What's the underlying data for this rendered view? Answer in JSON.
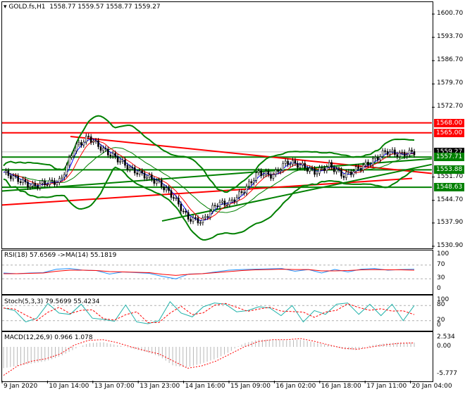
{
  "header": {
    "symbol": "GOLD.fs,H1",
    "ohlc": "1558.77 1559.57 1558.77 1559.27"
  },
  "price_axis": [
    "1600.70",
    "1593.70",
    "1586.70",
    "1579.70",
    "1572.70",
    "1551.70",
    "1544.70",
    "1537.90",
    "1530.90"
  ],
  "price_labels": [
    {
      "text": "1568.00",
      "price": 1568.0,
      "color": "#ff0000"
    },
    {
      "text": "1565.00",
      "price": 1565.0,
      "color": "#ff0000"
    },
    {
      "text": "1559.27",
      "price": 1559.27,
      "color": "#000000"
    },
    {
      "text": "1557.71",
      "price": 1557.71,
      "color": "#008000"
    },
    {
      "text": "1553.88",
      "price": 1553.88,
      "color": "#008000"
    },
    {
      "text": "1548.63",
      "price": 1548.63,
      "color": "#008000"
    }
  ],
  "closes": [
    1553.1,
    1551,
    1548.9,
    1550,
    1550.4,
    1560.5,
    1563.7,
    1560,
    1557.3,
    1554,
    1552.1,
    1549.9,
    1545.7,
    1539.4,
    1538.3,
    1543.6,
    1544,
    1547.8,
    1553.1,
    1552.1,
    1556.3,
    1555.2,
    1553.1,
    1555.2,
    1552.1,
    1554.2,
    1556.3,
    1559.5,
    1558.4,
    1559.27
  ],
  "rsi": {
    "label": "RSI(18) 57.6569  ->MA(14) 55.1819",
    "levels": [
      "100",
      "70",
      "30",
      "0"
    ],
    "values": [
      47,
      45,
      47,
      48,
      58,
      60,
      55,
      54,
      44,
      50,
      48,
      46,
      37,
      30,
      44,
      45,
      50,
      55,
      57,
      58,
      59,
      60,
      52,
      57,
      47,
      57,
      50,
      58,
      60,
      55,
      57,
      58
    ],
    "ma": [
      45,
      45,
      46,
      47,
      52,
      55,
      55,
      54,
      51,
      50,
      49,
      48,
      43,
      40,
      43,
      45,
      48,
      51,
      54,
      56,
      57,
      58,
      57,
      57,
      53,
      53,
      54,
      56,
      57,
      56,
      56,
      55
    ]
  },
  "stoch": {
    "label": "Stoch(5,3,3) 79.5699 55.4234",
    "levels": [
      "100",
      "80",
      "20",
      "0"
    ],
    "main": [
      70,
      60,
      15,
      30,
      88,
      50,
      45,
      85,
      30,
      25,
      18,
      82,
      15,
      8,
      20,
      95,
      50,
      35,
      75,
      90,
      85,
      55,
      60,
      75,
      70,
      40,
      80,
      15,
      60,
      45,
      85,
      90,
      45,
      85,
      40,
      85,
      20,
      80
    ]
  },
  "macd": {
    "label": "MACD(12,26,9) 0.966 1.078",
    "levels": [
      "2.534",
      "0.00",
      "-5.777"
    ],
    "hist": [
      -4.5,
      -4,
      -3.5,
      -3,
      -2,
      -0.5,
      1,
      1.3,
      0.5,
      -0.3,
      -1,
      -2,
      -4,
      -4.3,
      -3.5,
      -2.5,
      -1,
      1,
      2,
      2,
      1.8,
      2,
      1.2,
      0.5,
      -0.5,
      -0.7,
      0.5,
      1,
      1.2,
      1.2
    ],
    "signal": [
      -6,
      -4,
      -3,
      -2.5,
      -1.5,
      0.5,
      1.8,
      2,
      1.2,
      0,
      -0.8,
      -1.5,
      -3,
      -4.5,
      -4,
      -3,
      -1.5,
      0,
      1.5,
      2,
      2,
      2.3,
      1.5,
      0.5,
      -0.3,
      -0.5,
      0,
      0.6,
      1,
      1.1
    ]
  },
  "time_axis": [
    "9 Jan 2020",
    "10 Jan 14:00",
    "13 Jan 07:00",
    "13 Jan 23:00",
    "14 Jan 16:00",
    "15 Jan 09:00",
    "16 Jan 02:00",
    "16 Jan 18:00",
    "17 Jan 11:00",
    "20 Jan 04:00"
  ]
}
